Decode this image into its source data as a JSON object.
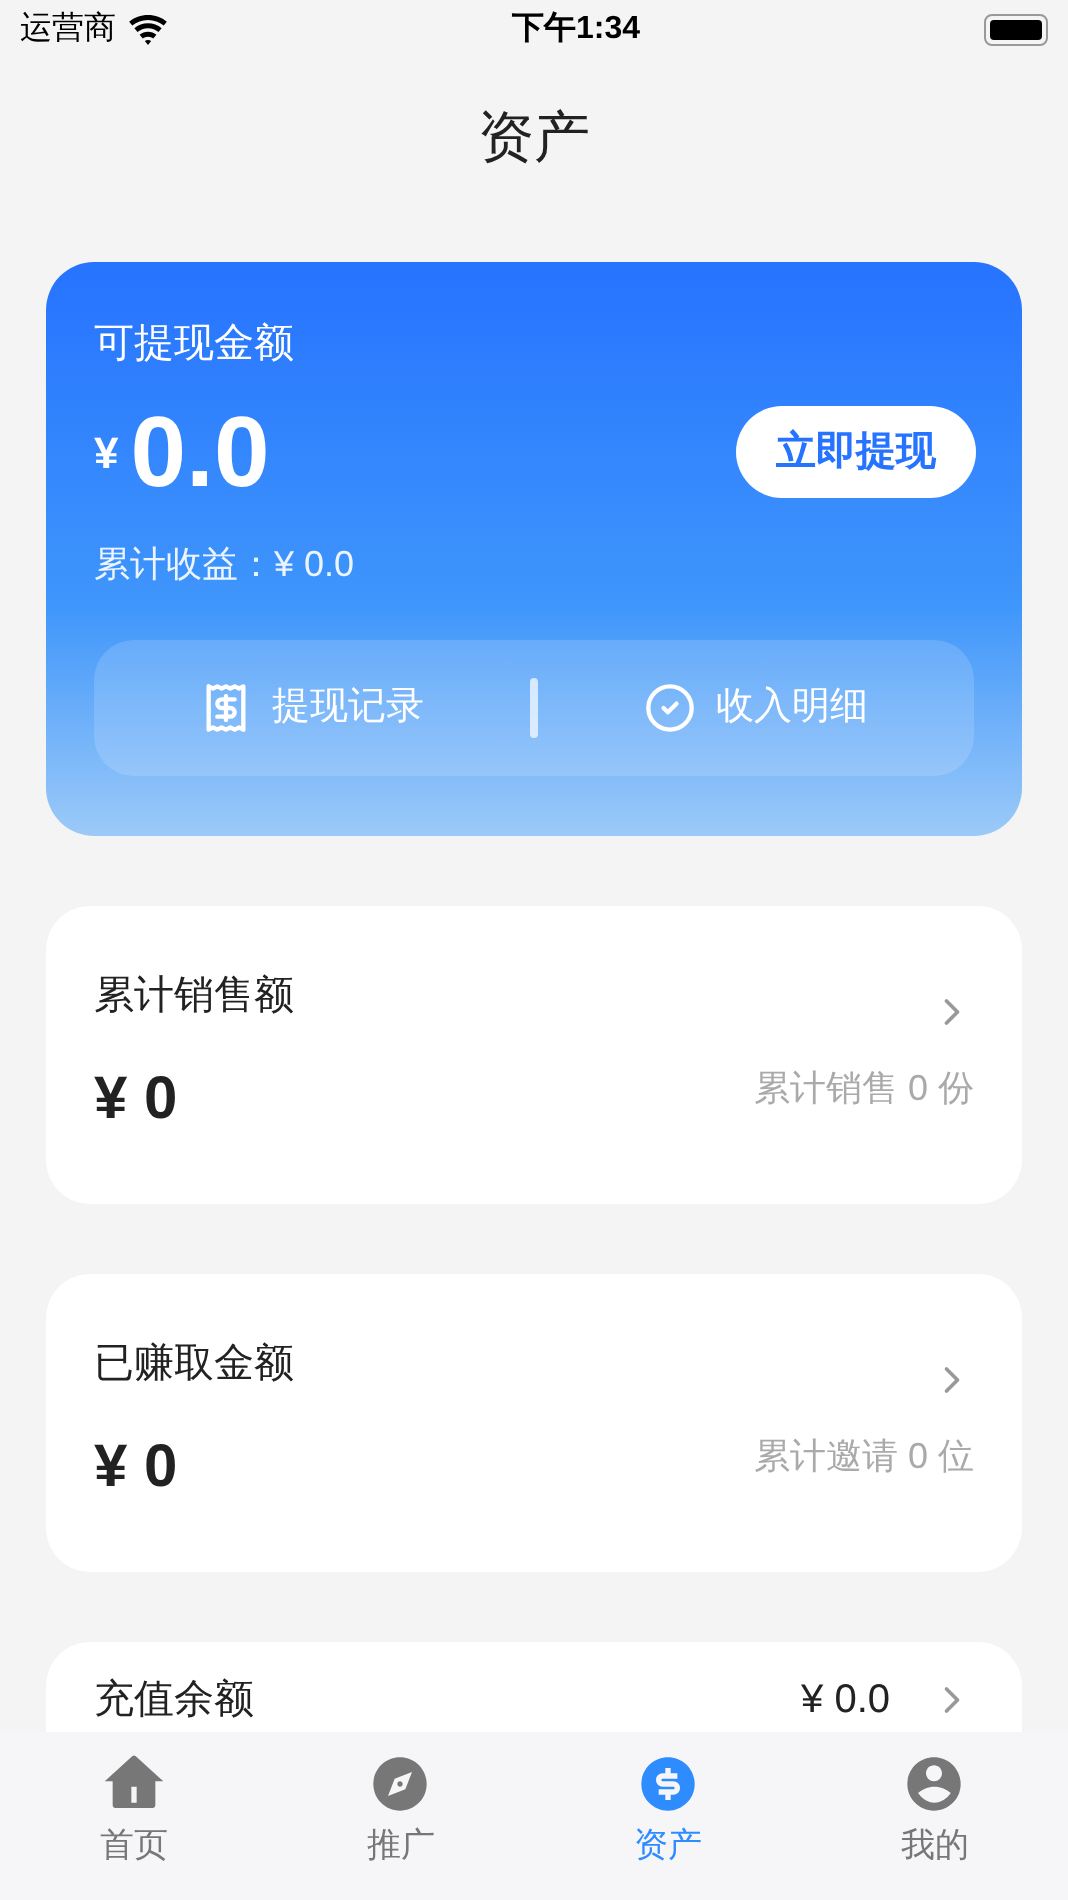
{
  "status_bar": {
    "carrier": "运营商",
    "time": "下午1:34"
  },
  "title": "资产",
  "balance_card": {
    "label": "可提现金额",
    "currency": "¥",
    "amount": "0.0",
    "withdraw_button": "立即提现",
    "cumulative": "累计收益：¥ 0.0",
    "actions": [
      {
        "label": "提现记录",
        "kind": "records"
      },
      {
        "label": "收入明细",
        "kind": "details"
      }
    ]
  },
  "stat_cards": [
    {
      "title": "累计销售额",
      "value": "¥ 0",
      "note": "累计销售 0 份"
    },
    {
      "title": "已赚取金额",
      "value": "¥ 0",
      "note": "累计邀请 0 位"
    }
  ],
  "recharge": {
    "title": "充值余额",
    "value": "¥ 0.0"
  },
  "tab_bar": [
    {
      "label": "首页",
      "kind": "home",
      "selected": false
    },
    {
      "label": "推广",
      "kind": "compass",
      "selected": false
    },
    {
      "label": "资产",
      "kind": "assets",
      "selected": true
    },
    {
      "label": "我的",
      "kind": "profile",
      "selected": false
    }
  ]
}
